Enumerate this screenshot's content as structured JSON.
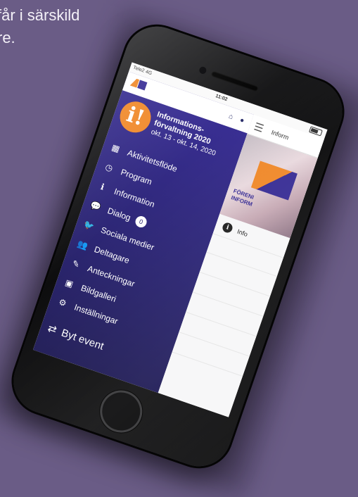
{
  "caption": "får i särskild\nre.",
  "status": {
    "carrier": "Tele2 4G",
    "time": "11:02"
  },
  "event": {
    "logo_glyph": "i!",
    "name": "Informations-förvaltning 2020",
    "date": "okt. 13 - okt. 14, 2020"
  },
  "menu": [
    {
      "label": "Aktivitetsflöde",
      "icon": "calendar-icon",
      "glyph": "▦"
    },
    {
      "label": "Program",
      "icon": "clock-icon",
      "glyph": "◷"
    },
    {
      "label": "Information",
      "icon": "info-icon",
      "glyph": "ℹ"
    },
    {
      "label": "Dialog",
      "icon": "chat-icon",
      "glyph": "💬",
      "badge": "0"
    },
    {
      "label": "Sociala medier",
      "icon": "twitter-icon",
      "glyph": "🐦"
    },
    {
      "label": "Deltagare",
      "icon": "users-icon",
      "glyph": "👥"
    },
    {
      "label": "Anteckningar",
      "icon": "pencil-icon",
      "glyph": "✎"
    },
    {
      "label": "Bildgalleri",
      "icon": "image-icon",
      "glyph": "▣"
    },
    {
      "label": "Inställningar",
      "icon": "gear-icon",
      "glyph": "⚙"
    }
  ],
  "switch_event": {
    "label": "Byt event",
    "icon": "swap-icon",
    "glyph": "⇄"
  },
  "content": {
    "title": "Inform",
    "banner_text": "FÖRENI\nINFORM",
    "info_label": "Info"
  },
  "colors": {
    "background": "#6a5c86",
    "drawer": "#2c2672",
    "accent": "#f08a2c"
  }
}
